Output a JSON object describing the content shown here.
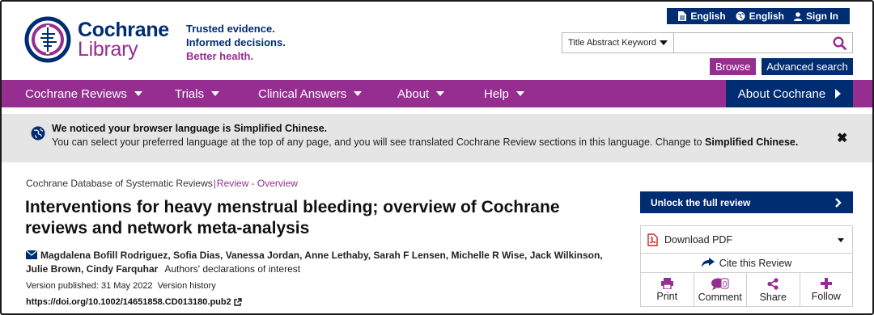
{
  "brand": {
    "name_line1": "Cochrane",
    "name_line2": "Library",
    "tagline_1": "Trusted evidence.",
    "tagline_2": "Informed decisions.",
    "tagline_3": "Better health."
  },
  "topbar": {
    "lang_doc": "English",
    "lang_globe": "English",
    "sign_in": "Sign In"
  },
  "search": {
    "scope": "Title Abstract Keyword",
    "value": "",
    "placeholder": ""
  },
  "actions_top": {
    "browse": "Browse",
    "advanced": "Advanced search"
  },
  "nav": {
    "items": [
      {
        "label": "Cochrane Reviews"
      },
      {
        "label": "Trials"
      },
      {
        "label": "Clinical Answers"
      },
      {
        "label": "About"
      },
      {
        "label": "Help"
      }
    ],
    "about_cochrane": "About Cochrane"
  },
  "notice": {
    "title": "We noticed your browser language is Simplified Chinese.",
    "body": "You can select your preferred language at the top of any page, and you will see translated Cochrane Review sections in this language. Change to",
    "link": "Simplified Chinese."
  },
  "article": {
    "source": "Cochrane Database of Systematic Reviews",
    "separator": "|",
    "type": "Review - Overview",
    "title": "Interventions for heavy menstrual bleeding; overview of Cochrane reviews and network meta-analysis",
    "authors": "Magdalena Bofill Rodriguez, Sofia Dias, Vanessa Jordan, Anne Lethaby, Sarah F Lensen, Michelle R Wise, Jack Wilkinson, Julie Brown, Cindy Farquhar",
    "declarations": "Authors' declarations of interest",
    "version": "Version published: 31 May 2022",
    "version_history": "Version history",
    "doi": "https://doi.org/10.1002/14651858.CD013180.pub2"
  },
  "side": {
    "unlock": "Unlock the full review",
    "download": "Download PDF",
    "cite": "Cite this Review",
    "comment_count": "0",
    "actions": [
      "Print",
      "Comment",
      "Share",
      "Follow"
    ]
  },
  "colors": {
    "navy": "#002d72",
    "purple": "#962d91",
    "notice_bg": "#e5e5e5"
  }
}
